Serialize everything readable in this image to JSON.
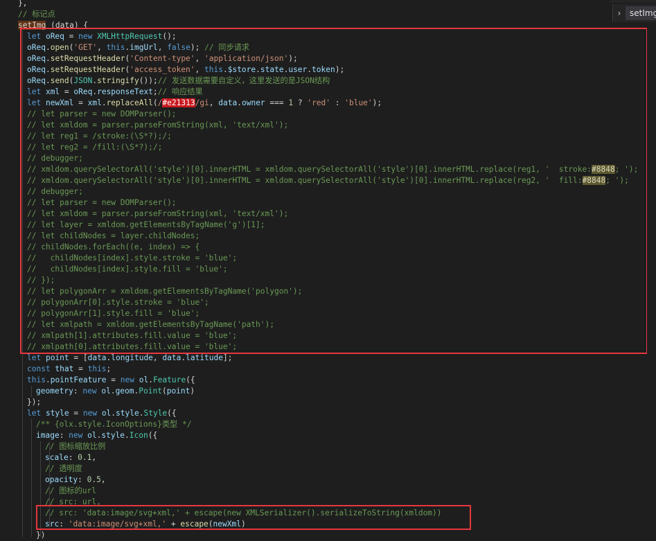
{
  "breadcrumb": {
    "label": "setImg"
  },
  "colors": {
    "keyword": "#569cd6",
    "class": "#4ec9b0",
    "function": "#dcdcaa",
    "property": "#9cdcfe",
    "string": "#ce9178",
    "comment": "#6a9955",
    "number": "#b5cea8",
    "highlight_red": "#c9181e",
    "highlight_olive": "#5e5b32",
    "annotation_box": "#e8373e",
    "background": "#1e1e1e"
  },
  "code_lines": [
    [
      [
        "op",
        "},"
      ]
    ],
    [
      [
        "cm",
        "// 标记点"
      ]
    ],
    [
      [
        "match",
        "setImg"
      ],
      [
        "op",
        " (data) {"
      ]
    ],
    [
      [
        "kw",
        "let "
      ],
      [
        "prop",
        "oReq"
      ],
      [
        "op",
        " = "
      ],
      [
        "kw",
        "new "
      ],
      [
        "cls",
        "XMLHttpRequest"
      ],
      [
        "op",
        "();"
      ]
    ],
    [
      [
        "prop",
        "oReq"
      ],
      [
        "op",
        "."
      ],
      [
        "fn",
        "open"
      ],
      [
        "op",
        "("
      ],
      [
        "str",
        "'GET'"
      ],
      [
        "op",
        ", "
      ],
      [
        "kw",
        "this"
      ],
      [
        "op",
        "."
      ],
      [
        "prop",
        "imgUrl"
      ],
      [
        "op",
        ", "
      ],
      [
        "kw",
        "false"
      ],
      [
        "op",
        "); "
      ],
      [
        "cm",
        "// 同步请求"
      ]
    ],
    [
      [
        "prop",
        "oReq"
      ],
      [
        "op",
        "."
      ],
      [
        "fn",
        "setRequestHeader"
      ],
      [
        "op",
        "("
      ],
      [
        "str",
        "'Content-type'"
      ],
      [
        "op",
        ", "
      ],
      [
        "str",
        "'application/json'"
      ],
      [
        "op",
        ");"
      ]
    ],
    [
      [
        "prop",
        "oReq"
      ],
      [
        "op",
        "."
      ],
      [
        "fn",
        "setRequestHeader"
      ],
      [
        "op",
        "("
      ],
      [
        "str",
        "'access_token'"
      ],
      [
        "op",
        ", "
      ],
      [
        "kw",
        "this"
      ],
      [
        "op",
        "."
      ],
      [
        "prop",
        "$store"
      ],
      [
        "op",
        "."
      ],
      [
        "prop",
        "state"
      ],
      [
        "op",
        "."
      ],
      [
        "prop",
        "user"
      ],
      [
        "op",
        "."
      ],
      [
        "prop",
        "token"
      ],
      [
        "op",
        ");"
      ]
    ],
    [
      [
        "prop",
        "oReq"
      ],
      [
        "op",
        "."
      ],
      [
        "fn",
        "send"
      ],
      [
        "op",
        "("
      ],
      [
        "cls",
        "JSON"
      ],
      [
        "op",
        "."
      ],
      [
        "fn",
        "stringify"
      ],
      [
        "op",
        "());"
      ],
      [
        "cm",
        "// 发送数据需要自定义，这里发送的是JSON结构"
      ]
    ],
    [
      [
        "kw",
        "let "
      ],
      [
        "prop",
        "xml"
      ],
      [
        "op",
        " = "
      ],
      [
        "prop",
        "oReq"
      ],
      [
        "op",
        "."
      ],
      [
        "prop",
        "responseText"
      ],
      [
        "op",
        ";"
      ],
      [
        "cm",
        "// 响应结果"
      ]
    ],
    [
      [
        "kw",
        "let "
      ],
      [
        "prop",
        "newXml"
      ],
      [
        "op",
        " = "
      ],
      [
        "prop",
        "xml"
      ],
      [
        "op",
        "."
      ],
      [
        "fn",
        "replaceAll"
      ],
      [
        "op",
        "("
      ],
      [
        "str",
        "/"
      ],
      [
        "hlred",
        "#e21313"
      ],
      [
        "str",
        "/gi"
      ],
      [
        "op",
        ", "
      ],
      [
        "prop",
        "data"
      ],
      [
        "op",
        "."
      ],
      [
        "prop",
        "owner"
      ],
      [
        "op",
        " === "
      ],
      [
        "num",
        "1"
      ],
      [
        "op",
        " ? "
      ],
      [
        "str",
        "'red'"
      ],
      [
        "op",
        " : "
      ],
      [
        "str",
        "'blue'"
      ],
      [
        "op",
        ");"
      ]
    ],
    [
      [
        "cm",
        "// let parser = new DOMParser();"
      ]
    ],
    [
      [
        "cm",
        "// let xmldom = parser.parseFromString(xml, 'text/xml');"
      ]
    ],
    [
      [
        "cm",
        "// let reg1 = /stroke:(\\S*?);/;"
      ]
    ],
    [
      [
        "cm",
        "// let reg2 = /fill:(\\S*?);/;"
      ]
    ],
    [
      [
        "cm",
        "// debugger;"
      ]
    ],
    [
      [
        "cm",
        "// xmldom.querySelectorAll('style')[0].innerHTML = xmldom.querySelectorAll('style')[0].innerHTML.replace(reg1, '  stroke:"
      ],
      [
        "hlolive",
        "#8848"
      ],
      [
        "cm",
        "; ');"
      ]
    ],
    [
      [
        "cm",
        "// xmldom.querySelectorAll('style')[0].innerHTML = xmldom.querySelectorAll('style')[0].innerHTML.replace(reg2, '  fill:"
      ],
      [
        "hlolive",
        "#8848"
      ],
      [
        "cm",
        "; ');"
      ]
    ],
    [
      [
        "cm",
        "// debugger;"
      ]
    ],
    [
      [
        "cm",
        "// let parser = new DOMParser();"
      ]
    ],
    [
      [
        "cm",
        "// let xmldom = parser.parseFromString(xml, 'text/xml');"
      ]
    ],
    [
      [
        "cm",
        "// let layer = xmldom.getElementsByTagName('g')[1];"
      ]
    ],
    [
      [
        "cm",
        "// let childNodes = layer.childNodes;"
      ]
    ],
    [
      [
        "cm",
        "// childNodes.forEach((e, index) => {"
      ]
    ],
    [
      [
        "cm",
        "//   childNodes[index].style.stroke = 'blue';"
      ]
    ],
    [
      [
        "cm",
        "//   childNodes[index].style.fill = 'blue';"
      ]
    ],
    [
      [
        "cm",
        "// });"
      ]
    ],
    [
      [
        "cm",
        "// let polygonArr = xmldom.getElementsByTagName('polygon');"
      ]
    ],
    [
      [
        "cm",
        "// polygonArr[0].style.stroke = 'blue';"
      ]
    ],
    [
      [
        "cm",
        "// polygonArr[1].style.fill = 'blue';"
      ]
    ],
    [
      [
        "cm",
        "// let xmlpath = xmldom.getElementsByTagName('path');"
      ]
    ],
    [
      [
        "cm",
        "// xmlpath[1].attributes.fill.value = 'blue';"
      ]
    ],
    [
      [
        "cm",
        "// xmlpath[0].attributes.fill.value = 'blue';"
      ]
    ],
    [
      [
        "kw",
        "let "
      ],
      [
        "prop",
        "point"
      ],
      [
        "op",
        " = ["
      ],
      [
        "prop",
        "data"
      ],
      [
        "op",
        "."
      ],
      [
        "prop",
        "longitude"
      ],
      [
        "op",
        ", "
      ],
      [
        "prop",
        "data"
      ],
      [
        "op",
        "."
      ],
      [
        "prop",
        "latitude"
      ],
      [
        "op",
        "];"
      ]
    ],
    [
      [
        "kw",
        "const "
      ],
      [
        "prop",
        "that"
      ],
      [
        "op",
        " = "
      ],
      [
        "kw",
        "this"
      ],
      [
        "op",
        ";"
      ]
    ],
    [
      [
        "kw",
        "this"
      ],
      [
        "op",
        "."
      ],
      [
        "prop",
        "pointFeature"
      ],
      [
        "op",
        " = "
      ],
      [
        "kw",
        "new "
      ],
      [
        "prop",
        "ol"
      ],
      [
        "op",
        "."
      ],
      [
        "cls",
        "Feature"
      ],
      [
        "op",
        "({"
      ]
    ],
    [
      [
        "prop",
        "geometry"
      ],
      [
        "op",
        ": "
      ],
      [
        "kw",
        "new "
      ],
      [
        "prop",
        "ol"
      ],
      [
        "op",
        "."
      ],
      [
        "prop",
        "geom"
      ],
      [
        "op",
        "."
      ],
      [
        "cls",
        "Point"
      ],
      [
        "op",
        "("
      ],
      [
        "prop",
        "point"
      ],
      [
        "op",
        ")"
      ]
    ],
    [
      [
        "op",
        "});"
      ]
    ],
    [
      [
        "kw",
        "let "
      ],
      [
        "prop",
        "style"
      ],
      [
        "op",
        " = "
      ],
      [
        "kw",
        "new "
      ],
      [
        "prop",
        "ol"
      ],
      [
        "op",
        "."
      ],
      [
        "prop",
        "style"
      ],
      [
        "op",
        "."
      ],
      [
        "cls",
        "Style"
      ],
      [
        "op",
        "({"
      ]
    ],
    [
      [
        "cm",
        "/** {olx.style.IconOptions}类型 */"
      ]
    ],
    [
      [
        "prop",
        "image"
      ],
      [
        "op",
        ": "
      ],
      [
        "kw",
        "new "
      ],
      [
        "prop",
        "ol"
      ],
      [
        "op",
        "."
      ],
      [
        "prop",
        "style"
      ],
      [
        "op",
        "."
      ],
      [
        "cls",
        "Icon"
      ],
      [
        "op",
        "({"
      ]
    ],
    [
      [
        "cm",
        "// 图标缩放比例"
      ]
    ],
    [
      [
        "prop",
        "scale"
      ],
      [
        "op",
        ": "
      ],
      [
        "num",
        "0.1"
      ],
      [
        "op",
        ","
      ]
    ],
    [
      [
        "cm",
        "// 透明度"
      ]
    ],
    [
      [
        "prop",
        "opacity"
      ],
      [
        "op",
        ": "
      ],
      [
        "num",
        "0.5"
      ],
      [
        "op",
        ","
      ]
    ],
    [
      [
        "cm",
        "// 图标的url"
      ]
    ],
    [
      [
        "cm",
        "// src: url,"
      ]
    ],
    [
      [
        "cm",
        "// src: 'data:image/svg+xml,' + escape(new XMLSerializer().serializeToString(xmldom))"
      ]
    ],
    [
      [
        "prop",
        "src"
      ],
      [
        "op",
        ": "
      ],
      [
        "str",
        "'data:image/svg+xml,'"
      ],
      [
        "op",
        " + "
      ],
      [
        "fn",
        "escape"
      ],
      [
        "op",
        "("
      ],
      [
        "prop",
        "newXml"
      ],
      [
        "op",
        ")"
      ]
    ],
    [
      [
        "op",
        "})"
      ]
    ]
  ]
}
